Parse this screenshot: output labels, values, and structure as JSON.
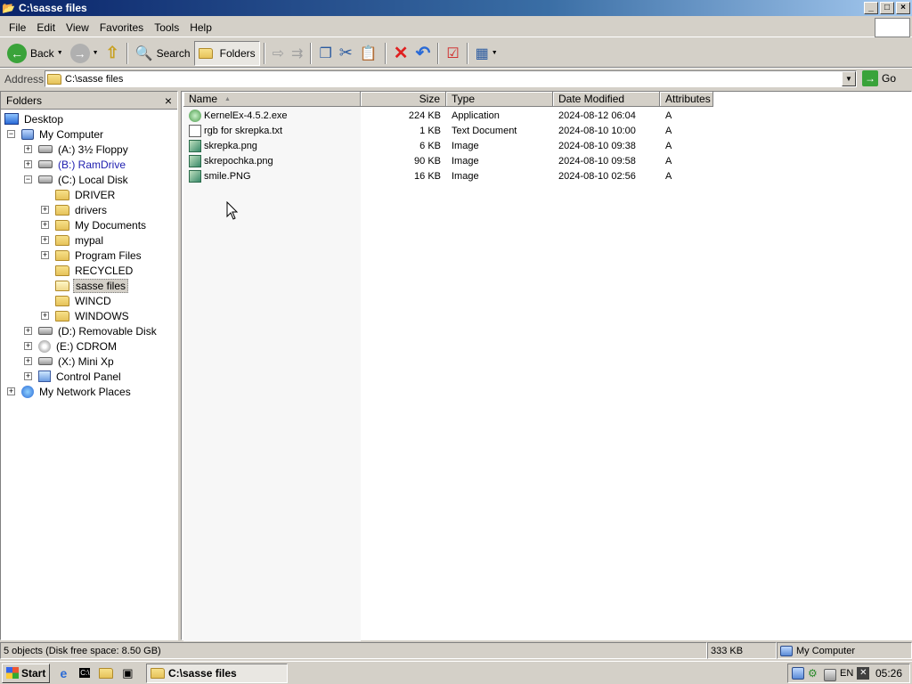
{
  "window": {
    "title": "C:\\sasse files"
  },
  "titlebar_buttons": {
    "minimize": "_",
    "maximize": "□",
    "close": "×"
  },
  "menu": [
    "File",
    "Edit",
    "View",
    "Favorites",
    "Tools",
    "Help"
  ],
  "toolbar": {
    "back": "Back",
    "search": "Search",
    "folders": "Folders"
  },
  "address": {
    "label": "Address",
    "value": "C:\\sasse files",
    "go": "Go"
  },
  "folders_pane": {
    "title": "Folders",
    "close": "×",
    "items": [
      {
        "label": "Desktop",
        "icon": "desktop-icon"
      },
      {
        "label": "My Computer",
        "icon": "my-computer-icon",
        "expander": "−"
      },
      {
        "label": "(A:) 3½ Floppy",
        "icon": "floppy-drive-icon",
        "expander": "+"
      },
      {
        "label": "(B:) RamDrive",
        "icon": "ram-drive-icon",
        "expander": "+"
      },
      {
        "label": "(C:) Local Disk",
        "icon": "local-disk-icon",
        "expander": "−"
      },
      {
        "label": "DRIVER",
        "icon": "folder-icon"
      },
      {
        "label": "drivers",
        "icon": "folder-icon",
        "expander": "+"
      },
      {
        "label": "My Documents",
        "icon": "folder-icon",
        "expander": "+"
      },
      {
        "label": "mypal",
        "icon": "folder-icon",
        "expander": "+"
      },
      {
        "label": "Program Files",
        "icon": "folder-icon",
        "expander": "+"
      },
      {
        "label": "RECYCLED",
        "icon": "folder-icon"
      },
      {
        "label": "sasse files",
        "icon": "open-folder-icon"
      },
      {
        "label": "WINCD",
        "icon": "folder-icon"
      },
      {
        "label": "WINDOWS",
        "icon": "folder-icon",
        "expander": "+"
      },
      {
        "label": "(D:) Removable Disk",
        "icon": "removable-disk-icon",
        "expander": "+"
      },
      {
        "label": "(E:) CDROM",
        "icon": "cdrom-icon",
        "expander": "+"
      },
      {
        "label": "(X:) Mini Xp",
        "icon": "drive-icon",
        "expander": "+"
      },
      {
        "label": "Control Panel",
        "icon": "control-panel-icon",
        "expander": "+"
      },
      {
        "label": "My Network Places",
        "icon": "network-places-icon",
        "expander": "+"
      }
    ]
  },
  "file_list": {
    "columns": {
      "name": "Name",
      "size": "Size",
      "type": "Type",
      "modified": "Date Modified",
      "attributes": "Attributes"
    },
    "sort_indicator": "▲",
    "rows": [
      {
        "name": "KernelEx-4.5.2.exe",
        "size": "224 KB",
        "type": "Application",
        "modified": "2024-08-12 06:04",
        "attributes": "A",
        "icon": "application-icon"
      },
      {
        "name": "rgb for skrepka.txt",
        "size": "1 KB",
        "type": "Text Document",
        "modified": "2024-08-10 10:00",
        "attributes": "A",
        "icon": "text-document-icon"
      },
      {
        "name": "skrepka.png",
        "size": "6 KB",
        "type": "Image",
        "modified": "2024-08-10 09:38",
        "attributes": "A",
        "icon": "image-file-icon"
      },
      {
        "name": "skrepochka.png",
        "size": "90 KB",
        "type": "Image",
        "modified": "2024-08-10 09:58",
        "attributes": "A",
        "icon": "image-file-icon"
      },
      {
        "name": "smile.PNG",
        "size": "16 KB",
        "type": "Image",
        "modified": "2024-08-10 02:56",
        "attributes": "A",
        "icon": "image-file-icon"
      }
    ]
  },
  "status": {
    "objects": "5 objects (Disk free space: 8.50 GB)",
    "size": "333 KB",
    "zone": "My Computer"
  },
  "taskbar": {
    "start": "Start",
    "task": "C:\\sasse files",
    "lang": "EN",
    "clock": "05:26"
  }
}
